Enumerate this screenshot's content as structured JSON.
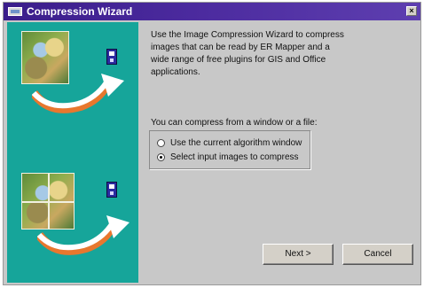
{
  "window": {
    "title": "Compression Wizard",
    "close_glyph": "×"
  },
  "content": {
    "description_lines": [
      "Use the Image Compression Wizard to compress",
      "images that can be read by ER Mapper and a",
      "wide range of free plugins for GIS and Office",
      "applications."
    ],
    "question": "You can compress from a window or a file:",
    "options": [
      {
        "label": "Use the current algorithm window",
        "checked": false
      },
      {
        "label": "Select input images to compress",
        "checked": true
      }
    ]
  },
  "buttons": {
    "next_label": "Next >",
    "cancel_label": "Cancel"
  },
  "icons": {
    "title": "app-window-icon",
    "disk": "floppy-disk-icon",
    "arrow": "curved-arrow-icon",
    "image": "satellite-image-icon"
  },
  "colors": {
    "titlebar": "#3a1d8a",
    "left_panel": "#16a59a",
    "dialog_bg": "#c8c8c8"
  }
}
